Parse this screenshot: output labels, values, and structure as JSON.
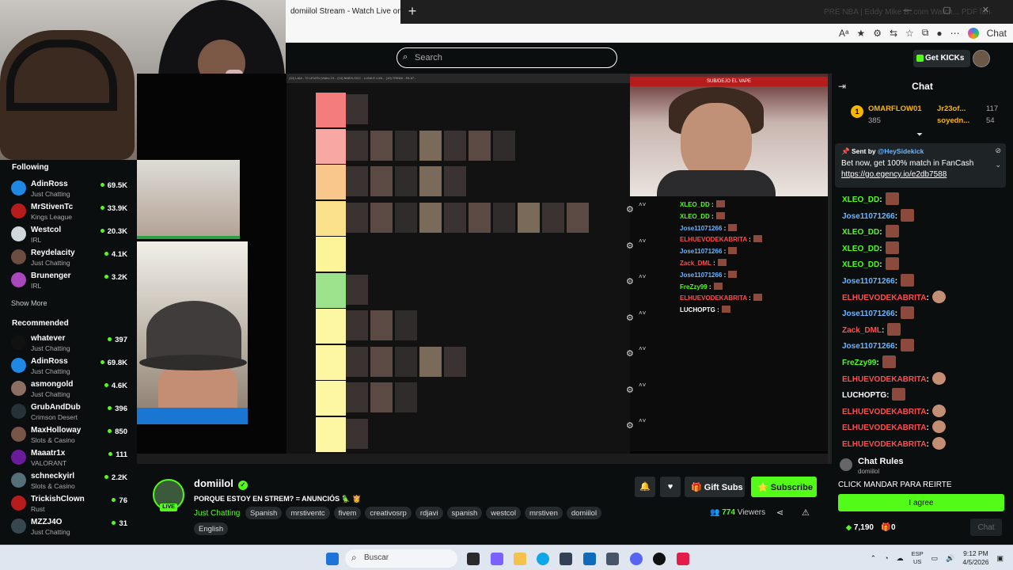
{
  "browser": {
    "tab_title": "domiilol Stream - Watch Live on K",
    "new_tab_glyph": "+",
    "right_faint_text": "PRE NBA  |  Eddy  Mike B..com  Watch...  PDF fan",
    "window_controls": "— ▢ ✕"
  },
  "header": {
    "search_placeholder": "Search",
    "get_kicks_label": "Get KICKs"
  },
  "sidebar": {
    "following_label": "Following",
    "following": [
      {
        "name": "AdinRoss",
        "category": "Just Chatting",
        "viewers": "69.5K"
      },
      {
        "name": "MrStivenTc",
        "category": "Kings League",
        "viewers": "33.9K"
      },
      {
        "name": "Westcol",
        "category": "IRL",
        "viewers": "20.3K"
      },
      {
        "name": "Reydelacity",
        "category": "Just Chatting",
        "viewers": "4.1K"
      },
      {
        "name": "Brunenger",
        "category": "IRL",
        "viewers": "3.2K"
      }
    ],
    "show_more_label": "Show More",
    "recommended_label": "Recommended",
    "recommended": [
      {
        "name": "whatever",
        "category": "Just Chatting",
        "viewers": "397"
      },
      {
        "name": "AdinRoss",
        "category": "Just Chatting",
        "viewers": "69.8K"
      },
      {
        "name": "asmongold",
        "category": "Just Chatting",
        "viewers": "4.6K"
      },
      {
        "name": "GrubAndDub",
        "category": "Crimson Desert",
        "viewers": "396"
      },
      {
        "name": "MaxHolloway",
        "category": "Slots & Casino",
        "viewers": "850"
      },
      {
        "name": "Maaatr1x",
        "category": "VALORANT",
        "viewers": "111"
      },
      {
        "name": "schneckyirl",
        "category": "Slots & Casino",
        "viewers": "2.2K"
      },
      {
        "name": "TrickishClown",
        "category": "Rust",
        "viewers": "76"
      },
      {
        "name": "MZZJ4O",
        "category": "Just Chatting",
        "viewers": "31"
      }
    ]
  },
  "player": {
    "inner_tabs": "(10) LAIA - 70 LEVEN (Video Of...   (10) BABYLOCC - LUNA E LUN...   (10) TRINNI - PA 87... ",
    "right_cam_banner": "SUB/DEJO EL VAPE",
    "inner_chat": [
      {
        "user": "XLEO_DD",
        "color": "#53fc18"
      },
      {
        "user": "XLEO_DD",
        "color": "#53fc18"
      },
      {
        "user": "Jose11071266",
        "color": "#6cb6ff"
      },
      {
        "user": "ELHUEVODEKABRITA",
        "color": "#ff4d4d"
      },
      {
        "user": "Jose11071266",
        "color": "#6cb6ff"
      },
      {
        "user": "Zack_DML",
        "color": "#ff4d4d"
      },
      {
        "user": "Jose11071266",
        "color": "#6cb6ff"
      },
      {
        "user": "FreZzy99",
        "color": "#53fc18"
      },
      {
        "user": "ELHUEVODEKABRITA",
        "color": "#ff4d4d"
      },
      {
        "user": "LUCHOPTG",
        "color": "#ffffff"
      }
    ]
  },
  "chat": {
    "title": "Chat",
    "top_gifters": [
      {
        "user": "OMARFLOW01",
        "count": "385"
      },
      {
        "user": "Jr23of...",
        "count": "117"
      },
      {
        "user": "soyedn...",
        "count": "54"
      }
    ],
    "sidekick": {
      "sent_by": "Sent by",
      "handle": "@HeySidekick",
      "message": "Bet now, get 100% match in FanCash",
      "link": "https://go.egency.io/e2db7588"
    },
    "messages": [
      {
        "user": "XLEO_DD",
        "color": "#53fc18",
        "emote": "brown"
      },
      {
        "user": "Jose11071266",
        "color": "#6cb6ff",
        "emote": "brown"
      },
      {
        "user": "XLEO_DD",
        "color": "#53fc18",
        "emote": "brown"
      },
      {
        "user": "XLEO_DD",
        "color": "#53fc18",
        "emote": "brown"
      },
      {
        "user": "XLEO_DD",
        "color": "#53fc18",
        "emote": "brown"
      },
      {
        "user": "Jose11071266",
        "color": "#6cb6ff",
        "emote": "brown"
      },
      {
        "user": "ELHUEVODEKABRITA",
        "color": "#ff4d4d",
        "emote": "face"
      },
      {
        "user": "Jose11071266",
        "color": "#6cb6ff",
        "emote": "brown"
      },
      {
        "user": "Zack_DML",
        "color": "#ff4d4d",
        "emote": "brown"
      },
      {
        "user": "Jose11071266",
        "color": "#6cb6ff",
        "emote": "brown"
      },
      {
        "user": "FreZzy99",
        "color": "#53fc18",
        "emote": "brown"
      },
      {
        "user": "ELHUEVODEKABRITA",
        "color": "#ff4d4d",
        "emote": "face"
      },
      {
        "user": "LUCHOPTG",
        "color": "#ffffff",
        "emote": "brown"
      },
      {
        "user": "ELHUEVODEKABRITA",
        "color": "#ff4d4d",
        "emote": "face"
      },
      {
        "user": "ELHUEVODEKABRITA",
        "color": "#ff4d4d",
        "emote": "face"
      },
      {
        "user": "ELHUEVODEKABRITA",
        "color": "#ff4d4d",
        "emote": "face"
      }
    ],
    "rules": {
      "title": "Chat Rules",
      "channel": "domiilol",
      "text": "CLICK MANDAR PARA REIRTE",
      "agree_label": "I agree"
    },
    "kicks": "7,190",
    "gifts": "0",
    "chat_button": "Chat"
  },
  "channel": {
    "name": "domiilol",
    "live_label": "LIVE",
    "title": "PORQUE ESTOY EN STREM? = ANUNCIÓS 🦜 👸",
    "category": "Just Chatting",
    "tags": [
      "Spanish",
      "mrstiventc",
      "fivem",
      "creativosrp",
      "rdjavi",
      "spanish",
      "westcol",
      "mrstiven",
      "domiilol"
    ],
    "language_tag": "English",
    "gift_subs_label": "Gift Subs",
    "subscribe_label": "Subscribe",
    "viewers_count": "774",
    "viewers_label": "Viewers"
  },
  "taskbar": {
    "search_placeholder": "Buscar",
    "lang_top": "ESP",
    "lang_bottom": "US",
    "time": "9:12 PM",
    "date": "4/5/2026"
  },
  "colors": {
    "accent": "#53fc18",
    "background": "#0b0e0f"
  }
}
